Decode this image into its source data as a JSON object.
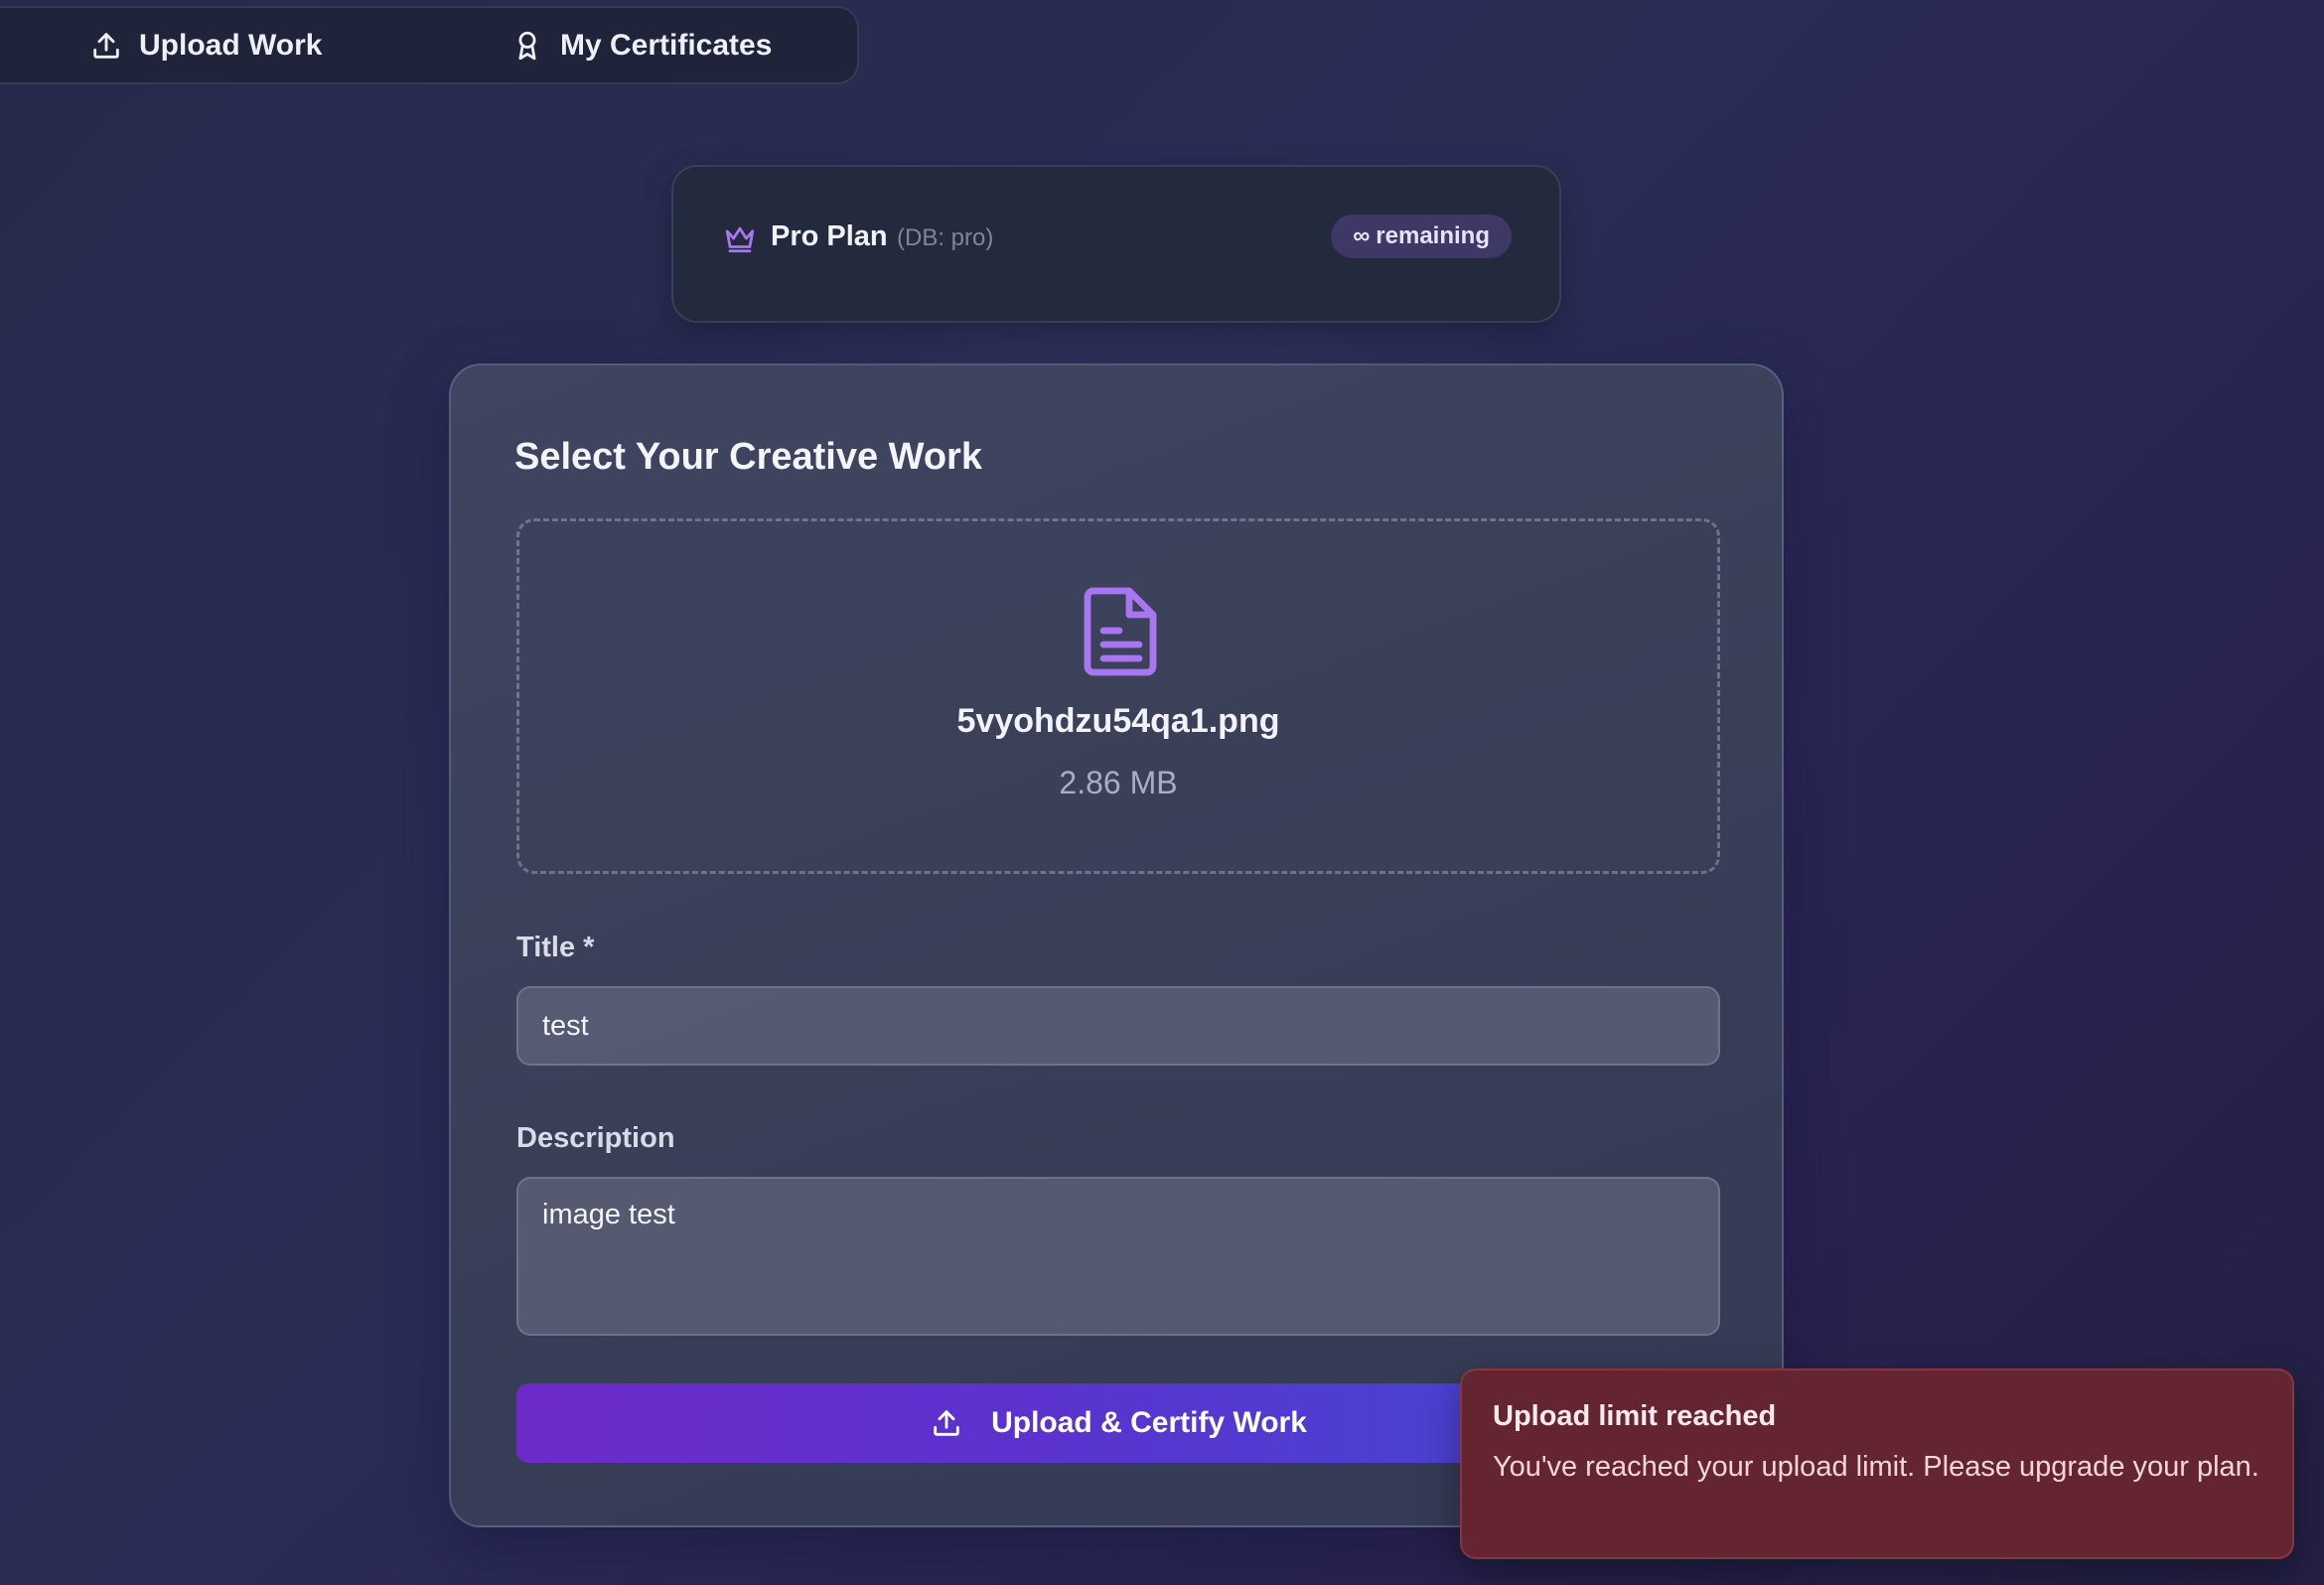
{
  "nav": {
    "upload_label": "Upload Work",
    "certificates_label": "My Certificates"
  },
  "plan": {
    "name": "Pro Plan",
    "db_note": "(DB: pro)",
    "badge_symbol": "∞",
    "badge_text": "remaining"
  },
  "form": {
    "section_title": "Select Your Creative Work",
    "file": {
      "name": "5vyohdzu54qa1.png",
      "size": "2.86 MB",
      "icon": "document-icon"
    },
    "title_label": "Title *",
    "title_value": "test",
    "description_label": "Description",
    "description_value": "image test",
    "submit_label": "Upload & Certify Work"
  },
  "toast": {
    "title": "Upload limit reached",
    "message": "You've reached your upload limit. Please upgrade your plan."
  },
  "colors": {
    "accent_purple": "#a776f0",
    "button_gradient_start": "#6d2ac8",
    "button_gradient_end": "#3f4bd3",
    "toast_bg": "#652530"
  }
}
